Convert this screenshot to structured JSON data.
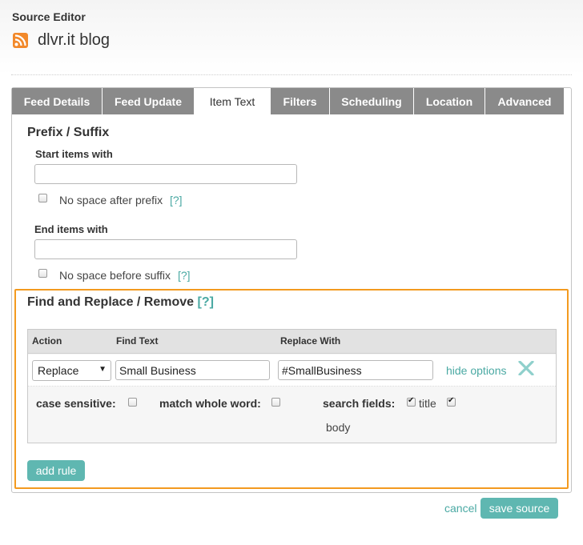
{
  "window": {
    "title": "Source Editor"
  },
  "source": {
    "name": "dlvr.it blog",
    "icon": "rss-icon"
  },
  "tabs": [
    {
      "label": "Feed Details",
      "active": false
    },
    {
      "label": "Feed Update",
      "active": false
    },
    {
      "label": "Item Text",
      "active": true
    },
    {
      "label": "Filters",
      "active": false
    },
    {
      "label": "Scheduling",
      "active": false
    },
    {
      "label": "Location",
      "active": false
    },
    {
      "label": "Advanced",
      "active": false
    }
  ],
  "prefix_suffix": {
    "heading": "Prefix / Suffix",
    "start_label": "Start items with",
    "start_value": "",
    "no_space_prefix_label": "No space after prefix",
    "no_space_prefix_checked": false,
    "help": "[?]",
    "end_label": "End items with",
    "end_value": "",
    "no_space_suffix_label": "No space before suffix",
    "no_space_suffix_checked": false
  },
  "find_replace": {
    "heading": "Find and Replace / Remove",
    "help": "[?]",
    "columns": {
      "action": "Action",
      "find": "Find Text",
      "replace": "Replace With"
    },
    "rule": {
      "action": "Replace",
      "find": "Small Business",
      "replace": "#SmallBusiness",
      "hide_options": "hide options",
      "case_sensitive_label": "case sensitive:",
      "case_sensitive": false,
      "match_whole_word_label": "match whole word:",
      "match_whole_word": false,
      "search_fields_label": "search fields:",
      "field_title_label": "title",
      "field_title": true,
      "field_body_label": "body",
      "field_body": true
    },
    "add_rule": "add rule"
  },
  "footer": {
    "cancel": "cancel",
    "save": "save source"
  },
  "colors": {
    "accent": "#5fb7b1",
    "highlight": "#f39a1f",
    "tab_inactive": "#8a8a8a"
  }
}
